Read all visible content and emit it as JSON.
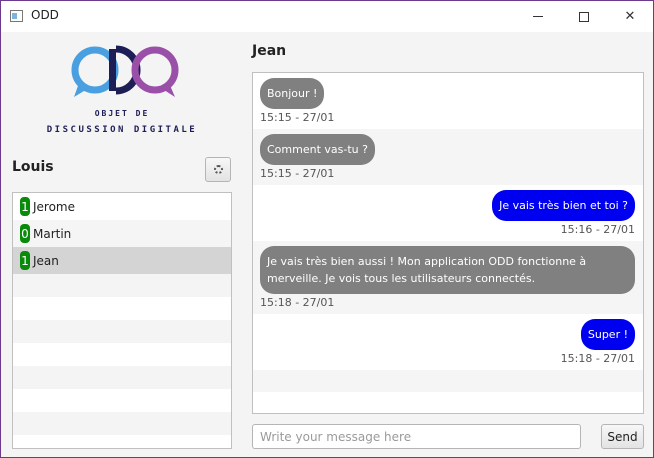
{
  "window": {
    "title": "ODD",
    "icon": "app-window-icon",
    "border_color": "#6b3a8c"
  },
  "logo": {
    "line1": "OBJET DE",
    "line2": "DISCUSSION DIGITALE",
    "colors": [
      "#4a9fe0",
      "#1e1e56",
      "#9a4fa8"
    ]
  },
  "sidebar": {
    "current_user": "Louis",
    "settings_icon": "gear-icon",
    "contacts": [
      {
        "count": "1",
        "name": "Jerome",
        "selected": false
      },
      {
        "count": "0",
        "name": "Martin",
        "selected": false
      },
      {
        "count": "1",
        "name": "Jean",
        "selected": true
      }
    ],
    "badge_color": "#0a8a0a"
  },
  "chat": {
    "title": "Jean",
    "messages": [
      {
        "direction": "in",
        "text": "Bonjour !",
        "time": "15:15 - 27/01"
      },
      {
        "direction": "in",
        "text": "Comment vas-tu ?",
        "time": "15:15 - 27/01"
      },
      {
        "direction": "out",
        "text": "Je vais très bien et toi ?",
        "time": "15:16 - 27/01"
      },
      {
        "direction": "in",
        "text": "Je vais très bien aussi ! Mon application ODD fonctionne à merveille. Je vois tous les utilisateurs connectés.",
        "time": "15:18 - 27/01"
      },
      {
        "direction": "out",
        "text": "Super !",
        "time": "15:18 - 27/01"
      }
    ],
    "incoming_color": "#808080",
    "outgoing_color": "#0000f0"
  },
  "composer": {
    "placeholder": "Write your message here",
    "value": "",
    "send_label": "Send"
  }
}
